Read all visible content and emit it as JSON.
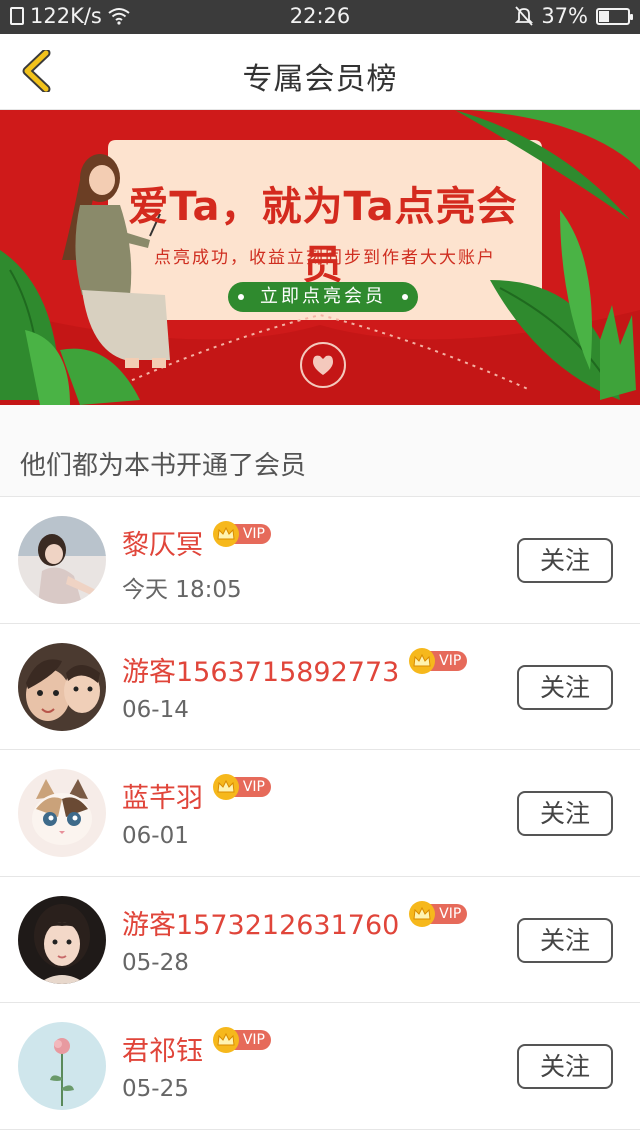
{
  "status_bar": {
    "speed": "122K/s",
    "time": "22:26",
    "battery": "37%",
    "battery_level": 0.37
  },
  "header": {
    "title": "专属会员榜"
  },
  "banner": {
    "title": "爱Ta，就为Ta点亮会员",
    "subtitle": "点亮成功，收益立刻同步到作者大大账户",
    "button": "立即点亮会员"
  },
  "section_label": "他们都为本书开通了会员",
  "vip_label": "VIP",
  "follow_label": "关注",
  "members": [
    {
      "name": "黎仄冥",
      "time": "今天 18:05"
    },
    {
      "name": "游客1563715892773",
      "time": "06-14"
    },
    {
      "name": "蓝芊羽",
      "time": "06-01"
    },
    {
      "name": "游客1573212631760",
      "time": "05-28"
    },
    {
      "name": "君祁钰",
      "time": "05-25"
    }
  ],
  "colors": {
    "accent_red": "#e0453a",
    "banner_red": "#cf1a1a",
    "banner_green": "#2f8a2e",
    "back_arrow": "#f2c21b"
  }
}
